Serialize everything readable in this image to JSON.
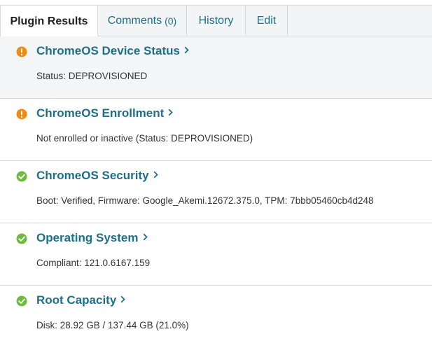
{
  "tabs": [
    {
      "label": "Plugin Results",
      "active": true
    },
    {
      "label": "Comments",
      "count": "(0)"
    },
    {
      "label": "History"
    },
    {
      "label": "Edit"
    }
  ],
  "colors": {
    "accent": "#1f6f87",
    "warning": "#f08a12",
    "success": "#6cbd3e"
  },
  "results": [
    {
      "title": "ChromeOS Device Status",
      "detail": "Status: DEPROVISIONED",
      "status": "warning",
      "icon": "exclamation-circle-icon"
    },
    {
      "title": "ChromeOS Enrollment",
      "detail": "Not enrolled or inactive (Status: DEPROVISIONED)",
      "status": "warning",
      "icon": "exclamation-circle-icon"
    },
    {
      "title": "ChromeOS Security",
      "detail": "Boot: Verified, Firmware: Google_Akemi.12672.375.0, TPM: 7bbb05460cb4d248",
      "status": "success",
      "icon": "check-circle-icon"
    },
    {
      "title": "Operating System",
      "detail": "Compliant: 121.0.6167.159",
      "status": "success",
      "icon": "check-circle-icon"
    },
    {
      "title": "Root Capacity",
      "detail": "Disk: 28.92 GB / 137.44 GB (21.0%)",
      "status": "success",
      "icon": "check-circle-icon"
    }
  ]
}
